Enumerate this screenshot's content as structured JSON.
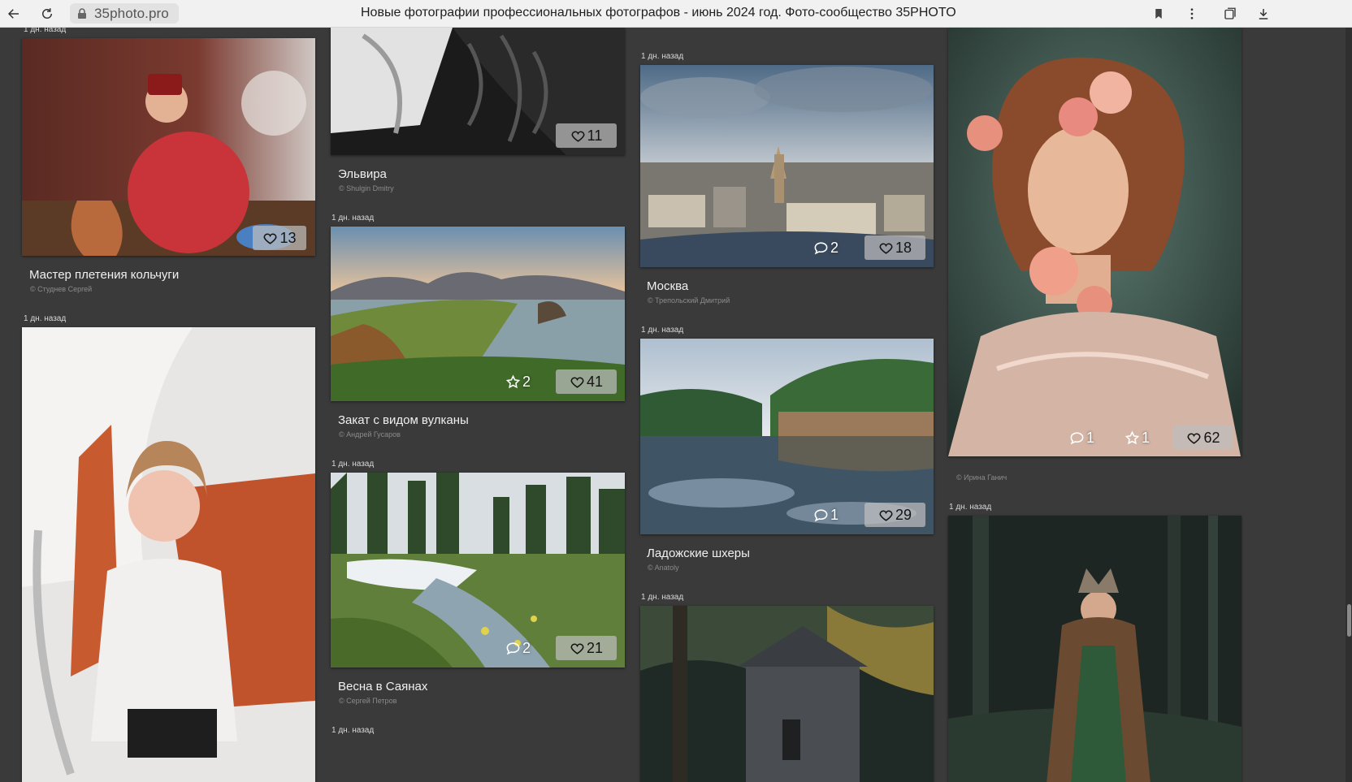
{
  "browser": {
    "url": "35photo.pro",
    "title": "Новые фотографии профессиональных фотографов - июнь 2024 год. Фото-сообщество 35PHOTO"
  },
  "icons": [
    "back-arrow-icon",
    "reload-icon",
    "lock-icon",
    "bookmark-icon",
    "kebab-menu-icon",
    "collections-icon",
    "download-icon",
    "heart-icon",
    "star-icon",
    "comment-icon"
  ],
  "colors": {
    "page_bg": "#3a3a3a",
    "like_badge": "#bebebe",
    "title_text": "#f0f0f0",
    "author_text": "#8b8b8b"
  },
  "feed": {
    "timestamps": [
      "1 дн. назад",
      "1 дн. назад",
      "1 дн. назад",
      "1 дн. назад",
      "1 дн. назад",
      "1 дн. назад",
      "1 дн. назад",
      "1 дн. назад",
      "1 дн. назад"
    ],
    "photos": [
      {
        "title": "Мастер плетения кольчуги",
        "author": "© Студнев Сергей",
        "likes": "13"
      },
      {
        "title": "",
        "author": "",
        "likes": ""
      },
      {
        "title": "Эльвира",
        "author": "© Shulgin Dmitry",
        "likes": "11"
      },
      {
        "title": "Закат с видом вулканы",
        "author": "© Андрей Гусаров",
        "likes": "41",
        "stars": "2"
      },
      {
        "title": "Весна в Саянах",
        "author": "© Сергей Петров",
        "likes": "21",
        "comments": "2"
      },
      {
        "title": "Москва",
        "author": "© Трепольский Дмитрий",
        "likes": "18",
        "comments": "2"
      },
      {
        "title": "Ладожские шхеры",
        "author": "© Anatoly",
        "likes": "29",
        "comments": "1"
      },
      {
        "title": "",
        "author": "",
        "likes": ""
      },
      {
        "title": "",
        "author": "© Ирина Ганич",
        "likes": "62",
        "stars": "1",
        "comments": "1"
      },
      {
        "title": "",
        "author": "",
        "likes": ""
      }
    ]
  }
}
